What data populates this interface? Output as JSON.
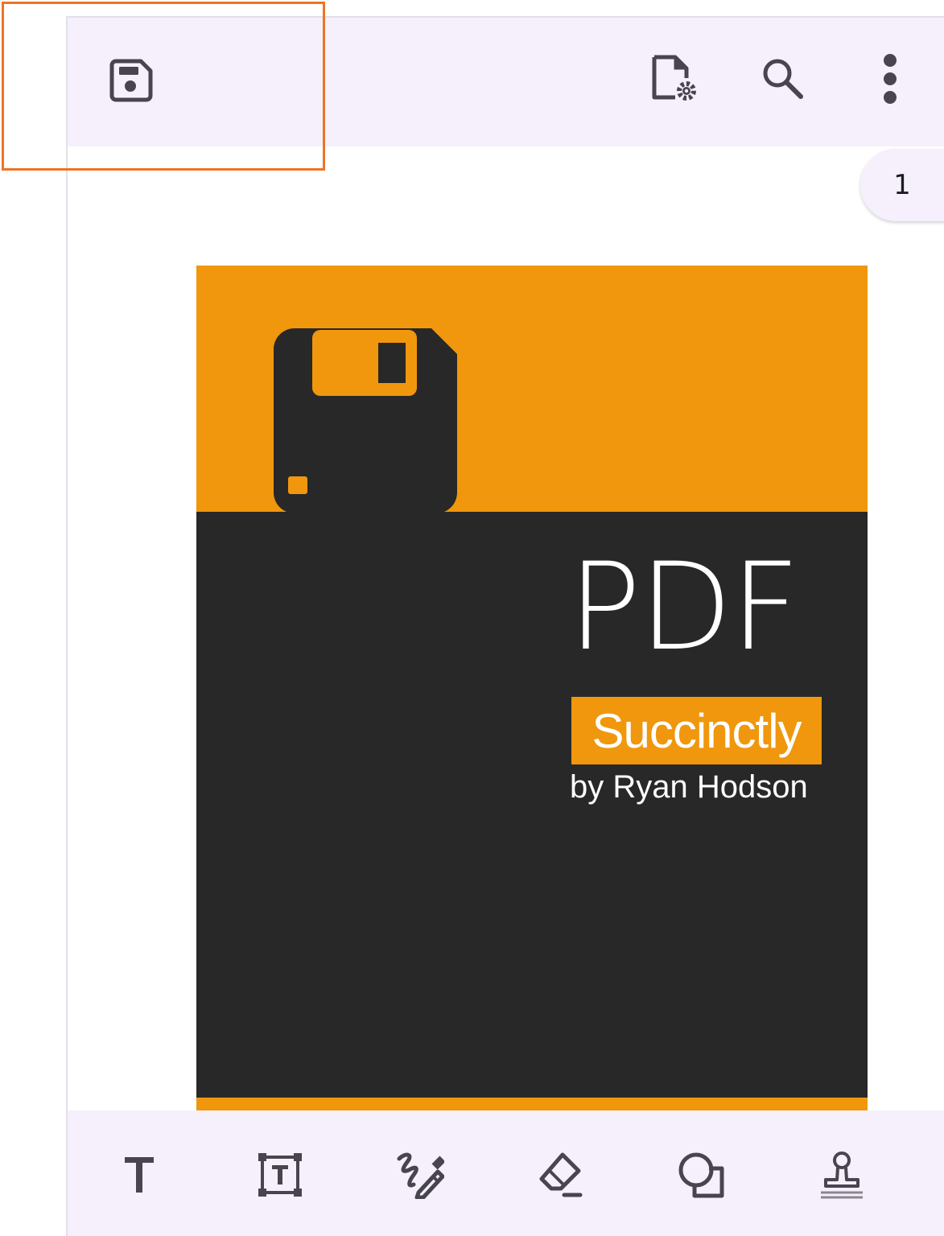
{
  "header": {
    "icons": {
      "save": "save-icon",
      "document_settings": "document-settings-icon",
      "search": "search-icon",
      "more": "more-vert-icon"
    }
  },
  "page_indicator": {
    "page": "1"
  },
  "document": {
    "title": "PDF",
    "subtitle": "Succinctly",
    "author": "by Ryan Hodson",
    "colors": {
      "accent": "#f0970d",
      "dark": "#282828"
    }
  },
  "bottom_toolbar": {
    "tools": [
      "text-icon",
      "text-box-icon",
      "ink-icon",
      "eraser-icon",
      "shapes-icon",
      "stamp-icon"
    ]
  },
  "colors": {
    "bar_background": "#f5f0fc",
    "icon": "#49454f",
    "highlight": "#ef7422"
  }
}
